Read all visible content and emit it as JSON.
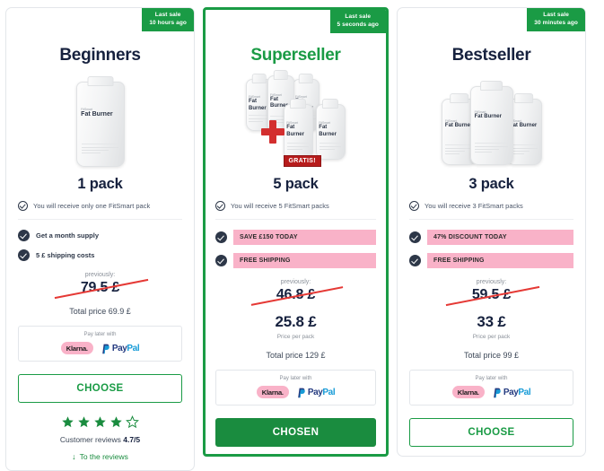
{
  "plans": [
    {
      "badge": {
        "line1": "Last sale",
        "line2": "10 hours ago"
      },
      "title": "Beginners",
      "pack_count": "1 pack",
      "receive_text": "You will receive only one FitSmart pack",
      "features": [
        {
          "text": "Get a month supply",
          "style": "plain"
        },
        {
          "text": "5 £ shipping costs",
          "style": "plain"
        }
      ],
      "previously_label": "previously:",
      "old_price": "79.5 £",
      "new_price": "",
      "per_pack_label": "",
      "total_price": "Total price 69.9  £",
      "pay_later_label": "Pay later with",
      "klarna_label": "Klarna.",
      "paypal_label_a": "Pay",
      "paypal_label_b": "Pal",
      "button_label": "CHOOSE",
      "button_style": "outline",
      "rating": {
        "filled": 4,
        "total": 5,
        "text_prefix": "Customer reviews ",
        "text_value": "4.7/5"
      },
      "to_reviews": "To the reviews",
      "bottle_brand": "FitSmart",
      "bottle_name": "Fat Burner"
    },
    {
      "badge": {
        "line1": "Last sale",
        "line2": "5 seconds ago"
      },
      "title": "Superseller",
      "pack_count": "5 pack",
      "receive_text": "You will receive 5 FitSmart packs",
      "gratis_label": "GRATIS!",
      "features": [
        {
          "text": "SAVE £150 TODAY",
          "style": "highlight"
        },
        {
          "text": "FREE SHIPPING",
          "style": "highlight"
        }
      ],
      "previously_label": "previously:",
      "old_price": "46.8 £",
      "new_price": "25.8 £",
      "per_pack_label": "Price per pack",
      "total_price": "Total price 129  £",
      "pay_later_label": "Pay later with",
      "klarna_label": "Klarna.",
      "paypal_label_a": "Pay",
      "paypal_label_b": "Pal",
      "button_label": "CHOSEN",
      "button_style": "solid",
      "bottle_brand": "FitSmart",
      "bottle_name": "Fat Burner"
    },
    {
      "badge": {
        "line1": "Last sale",
        "line2": "30 minutes ago"
      },
      "title": "Bestseller",
      "pack_count": "3 pack",
      "receive_text": "You will receive 3 FitSmart packs",
      "features": [
        {
          "text": "47% DISCOUNT TODAY",
          "style": "highlight"
        },
        {
          "text": "FREE SHIPPING",
          "style": "highlight"
        }
      ],
      "previously_label": "previously:",
      "old_price": "59.5 £",
      "new_price": "33 £",
      "per_pack_label": "Price per pack",
      "total_price": "Total price 99  £",
      "pay_later_label": "Pay later with",
      "klarna_label": "Klarna.",
      "paypal_label_a": "Pay",
      "paypal_label_b": "Pal",
      "button_label": "CHOOSE",
      "button_style": "outline",
      "bottle_brand": "FitSmart",
      "bottle_name": "Fat Burner"
    }
  ],
  "colors": {
    "green": "#1a9b45",
    "green_dark": "#1a8c3f",
    "pink": "#f9b2c8",
    "navy": "#16213e",
    "red": "#e53935",
    "gratis_red": "#b71c1c"
  }
}
